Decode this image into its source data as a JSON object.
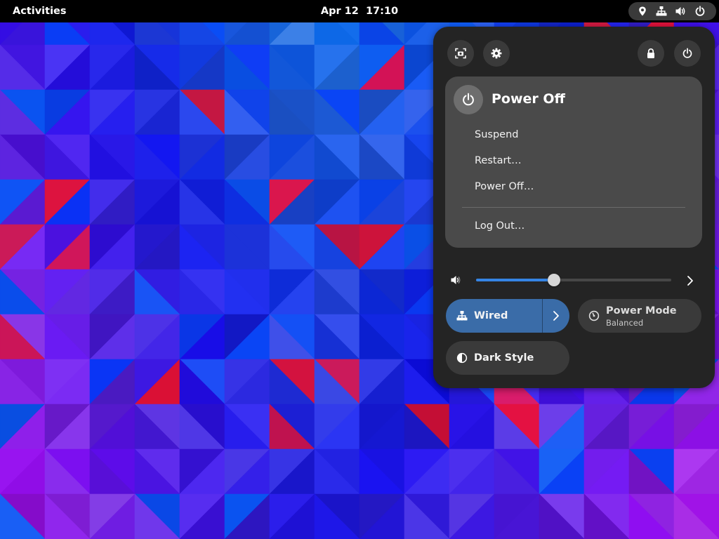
{
  "topbar": {
    "activities_label": "Activities",
    "clock_label": "Apr 12  17:10",
    "indicators": [
      "location-icon",
      "network-wired-icon",
      "volume-icon",
      "power-icon"
    ]
  },
  "quick_settings": {
    "top_buttons": {
      "screenshot": "screenshot-icon",
      "settings": "gear-icon",
      "lock": "lock-icon",
      "power": "power-icon"
    },
    "power_menu": {
      "title": "Power Off",
      "items": [
        {
          "label": "Suspend"
        },
        {
          "label": "Restart…"
        },
        {
          "label": "Power Off…"
        },
        {
          "label": "Log Out…"
        }
      ]
    },
    "volume": {
      "level_fraction": 0.4
    },
    "toggles": {
      "wired": {
        "label": "Wired",
        "active": true
      },
      "power_mode": {
        "label": "Power Mode",
        "value": "Balanced",
        "active": false
      },
      "dark_style": {
        "label": "Dark Style",
        "active": false
      }
    }
  },
  "colors": {
    "accent": "#3584e4",
    "active_tile": "#3a6ca8",
    "panel_bg": "#242424",
    "submenu_bg": "#4a4a4a",
    "tile_bg": "#3a3a3a",
    "topbar_bg": "#000000"
  }
}
